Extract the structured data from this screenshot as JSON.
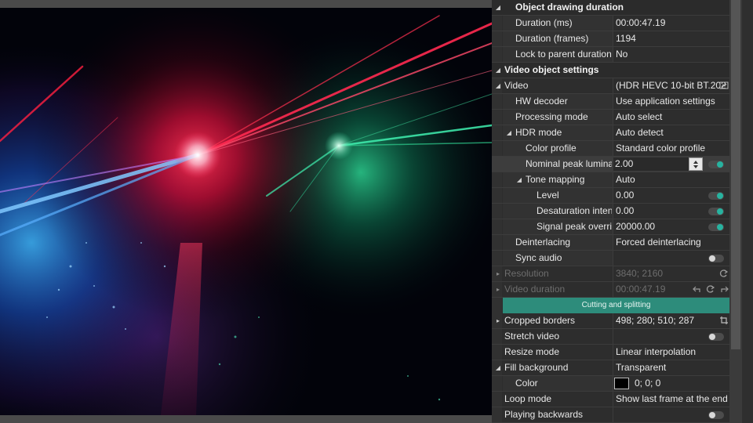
{
  "panel": {
    "sections": {
      "object_drawing": "Object drawing duration",
      "video_object": "Video object settings"
    },
    "rows": {
      "duration_ms": {
        "label": "Duration (ms)",
        "value": "00:00:47.19"
      },
      "duration_frames": {
        "label": "Duration (frames)",
        "value": "1194"
      },
      "lock_parent": {
        "label": "Lock to parent duration",
        "value": "No"
      },
      "video": {
        "label": "Video",
        "value": "(HDR HEVC 10-bit BT.202"
      },
      "hw_decoder": {
        "label": "HW decoder",
        "value": "Use application settings"
      },
      "processing_mode": {
        "label": "Processing mode",
        "value": "Auto select"
      },
      "hdr_mode": {
        "label": "HDR mode",
        "value": "Auto detect"
      },
      "color_profile": {
        "label": "Color profile",
        "value": "Standard color profile"
      },
      "nominal_peak": {
        "label": "Nominal peak lumina",
        "value": "2.00"
      },
      "tone_mapping": {
        "label": "Tone mapping",
        "value": "Auto"
      },
      "level": {
        "label": "Level",
        "value": "0.00"
      },
      "desaturation": {
        "label": "Desaturation inten",
        "value": "0.00"
      },
      "signal_peak": {
        "label": "Signal peak overri",
        "value": "20000.00"
      },
      "deinterlacing": {
        "label": "Deinterlacing",
        "value": "Forced deinterlacing"
      },
      "sync_audio": {
        "label": "Sync audio",
        "value": ""
      },
      "resolution": {
        "label": "Resolution",
        "value": "3840; 2160"
      },
      "video_duration": {
        "label": "Video duration",
        "value": "00:00:47.19"
      },
      "cropped_borders": {
        "label": "Cropped borders",
        "value": "498; 280; 510; 287"
      },
      "stretch_video": {
        "label": "Stretch video",
        "value": ""
      },
      "resize_mode": {
        "label": "Resize mode",
        "value": "Linear interpolation"
      },
      "fill_background": {
        "label": "Fill background",
        "value": "Transparent"
      },
      "color": {
        "label": "Color",
        "value": "0; 0; 0"
      },
      "loop_mode": {
        "label": "Loop mode",
        "value": "Show last frame at the end o"
      },
      "playing_backwards": {
        "label": "Playing backwards",
        "value": ""
      }
    },
    "cutting_button": "Cutting and splitting",
    "toggles": {
      "nominal_peak": true,
      "level": true,
      "desaturation": true,
      "signal_peak": true,
      "sync_audio": false,
      "stretch_video": false,
      "playing_backwards": false
    }
  },
  "colors": {
    "accent": "#27b3a0",
    "button": "#2d8c7b",
    "panel_bg": "#2d2d2d",
    "swatch": "#000000"
  },
  "icons": [
    "video-file-icon",
    "reset-icon",
    "undo-icon",
    "redo-icon",
    "crop-icon",
    "spin-up-icon",
    "spin-down-icon"
  ]
}
